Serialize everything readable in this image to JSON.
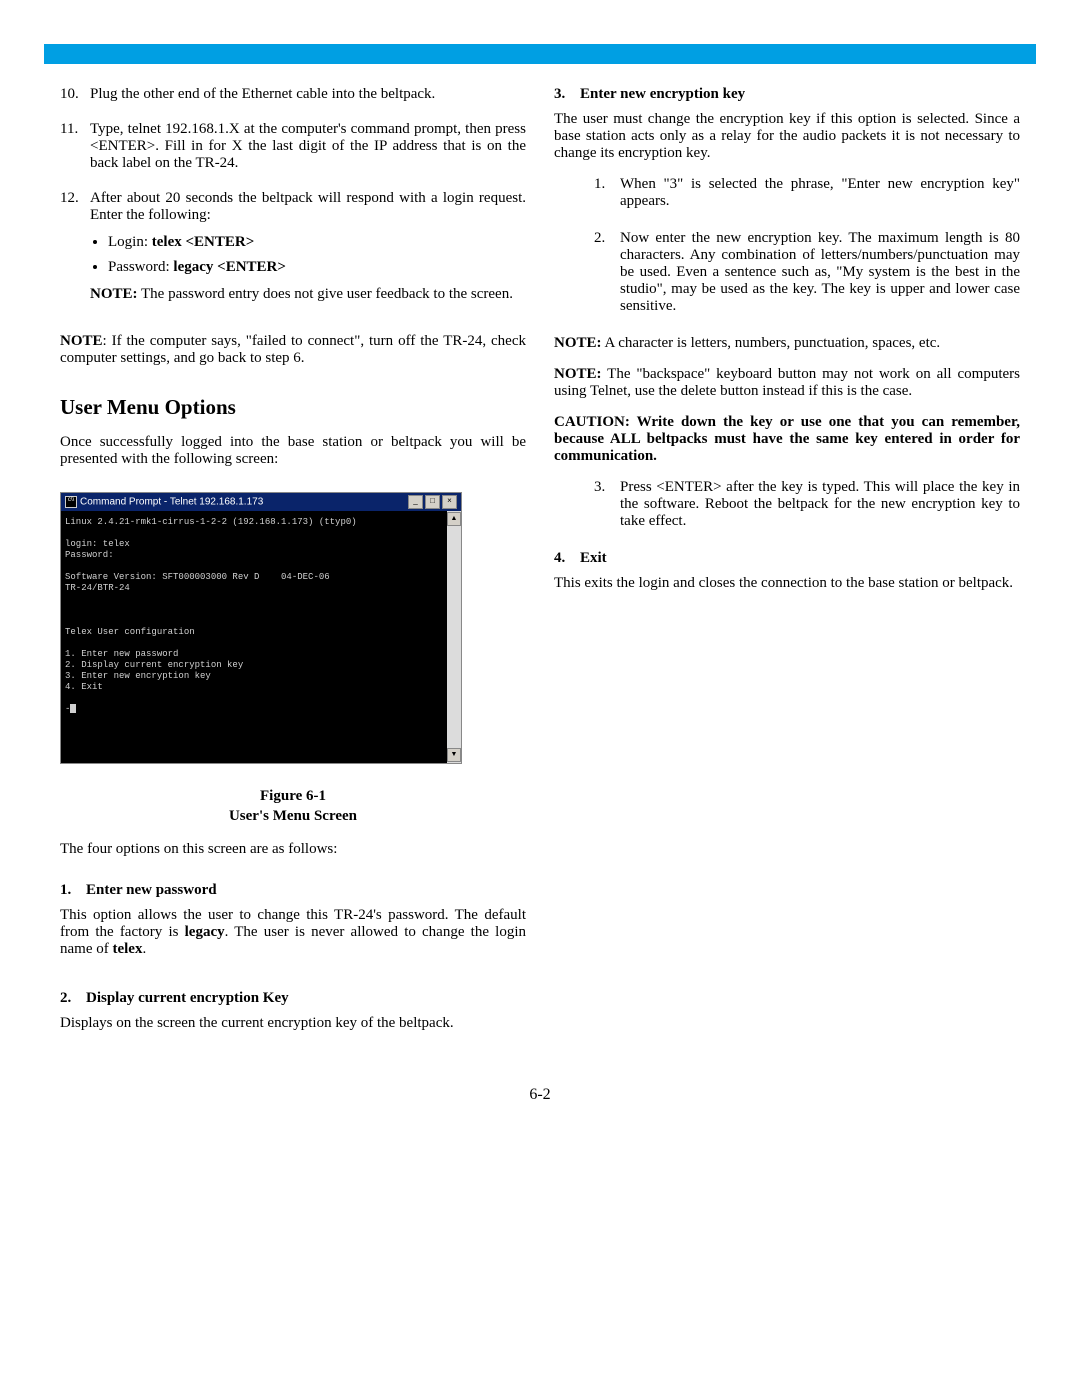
{
  "left": {
    "steps": [
      {
        "n": "10.",
        "text": "Plug the other end of the Ethernet cable into the beltpack."
      },
      {
        "n": "11.",
        "text": "Type, telnet 192.168.1.X at the computer's command prompt, then press <ENTER>. Fill in for X the last digit of the IP address that is on the back label on the TR-24."
      },
      {
        "n": "12.",
        "text": "After about 20 seconds the beltpack will respond with a login request. Enter the following:"
      }
    ],
    "login_label": "Login: ",
    "login_bold": "telex <ENTER>",
    "pass_label": "Password: ",
    "pass_bold": "legacy <ENTER>",
    "note1_label": "NOTE:",
    "note1_text": " The password entry does not give user feedback to the screen.",
    "note2_label": "NOTE",
    "note2_text": ": If the computer says, \"failed to connect\", turn off the TR-24, check computer settings, and go back to step 6.",
    "section_title": "User Menu Options",
    "section_intro": "Once successfully logged into the base station or  beltpack you will be presented with the following screen:",
    "cmd_title": "Command Prompt - Telnet 192.168.1.173",
    "terminal_lines": "Linux 2.4.21-rmk1-cirrus-1-2-2 (192.168.1.173) (ttyp0)\n\nlogin: telex\nPassword:\n\nSoftware Version: SFT000003000 Rev D    04-DEC-06\nTR-24/BTR-24\n\n\n\nTelex User configuration\n\n1. Enter new password\n2. Display current encryption key\n3. Enter new encryption key\n4. Exit\n\n-",
    "fig_caption_1": "Figure 6-1",
    "fig_caption_2": "User's Menu Screen",
    "four_opts": "The four options on this screen are as follows:",
    "opt1_head_n": "1.",
    "opt1_head": "Enter new password",
    "opt1_body_a": "This option allows the user to change this TR-24's password. The default from the factory is ",
    "opt1_body_bold": "legacy",
    "opt1_body_b": ". The user is never allowed to change the login name of ",
    "opt1_body_bold2": "telex",
    "opt1_body_c": ".",
    "opt2_head_n": "2.",
    "opt2_head": "Display current encryption Key",
    "opt2_body": "Displays on the screen the current encryption key of the beltpack."
  },
  "right": {
    "opt3_head_n": "3.",
    "opt3_head": "Enter new encryption key",
    "opt3_intro": "The user must change the encryption key if this option is selected. Since a base station acts only as a relay for the audio packets it is not necessary to change its encryption key.",
    "opt3_steps": [
      {
        "n": "1.",
        "text": "When \"3\" is selected the phrase, \"Enter new encryption key\" appears."
      },
      {
        "n": "2.",
        "text": "Now enter the new encryption key. The maximum length is 80 characters. Any combination of letters/numbers/punctuation may be used. Even a sentence such as, \"My system is the best in the studio\", may be used as the key. The key is upper and lower case sensitive."
      }
    ],
    "note3_label": "NOTE:",
    "note3_text": " A character is letters, numbers, punctuation, spaces, etc.",
    "note4_label": "NOTE:",
    "note4_text": " The \"backspace\" keyboard button may not work on all computers using Telnet, use the delete button instead if this is the case.",
    "caution": "CAUTION: Write down the key or use one that you can remember, because ALL beltpacks must have the same key entered in order for communication.",
    "opt3_step3": {
      "n": "3.",
      "text": "Press <ENTER> after the key is typed. This will place the key in the software. Reboot the beltpack for the new encryption key to take effect."
    },
    "opt4_head_n": "4.",
    "opt4_head": "Exit",
    "opt4_body": "This exits the login and closes the connection to the base station or beltpack."
  },
  "page_number": "6-2"
}
